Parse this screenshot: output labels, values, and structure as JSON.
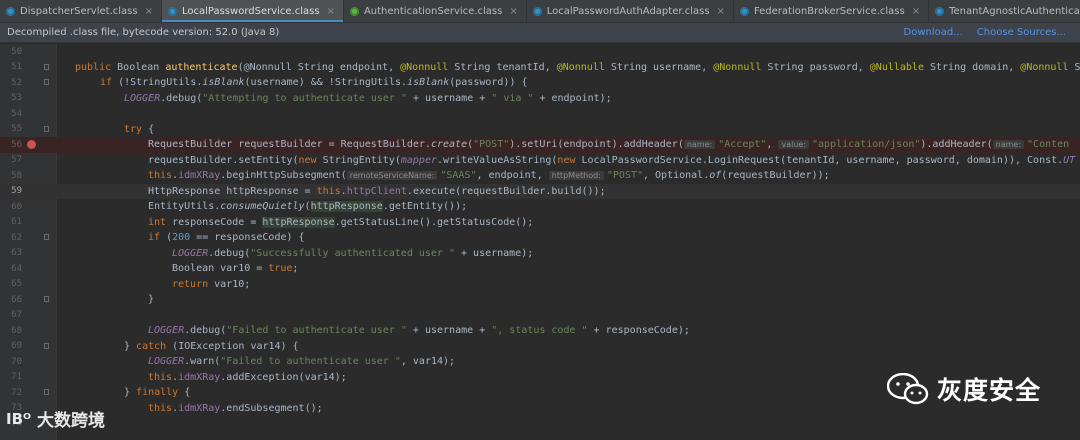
{
  "tabs": [
    {
      "label": "DispatcherServlet.class",
      "icon": "java-class-icon",
      "active": false
    },
    {
      "label": "LocalPasswordService.class",
      "icon": "java-class-icon",
      "active": true
    },
    {
      "label": "AuthenticationService.class",
      "icon": "java-class-green-icon",
      "active": false
    },
    {
      "label": "LocalPasswordAuthAdapter.class",
      "icon": "java-class-icon",
      "active": false
    },
    {
      "label": "FederationBrokerService.class",
      "icon": "java-class-icon",
      "active": false
    },
    {
      "label": "TenantAgnosticAuthenticationController.class",
      "icon": "java-class-icon",
      "active": false
    }
  ],
  "banner": {
    "message": "Decompiled .class file, bytecode version: 52.0 (Java 8)",
    "download_label": "Download...",
    "choose_sources_label": "Choose Sources..."
  },
  "editor": {
    "current_line": "59",
    "breakpoint_line": "56",
    "lines": [
      {
        "n": "50"
      },
      {
        "n": "51"
      },
      {
        "n": "52"
      },
      {
        "n": "53"
      },
      {
        "n": "54"
      },
      {
        "n": "55"
      },
      {
        "n": "56"
      },
      {
        "n": "57"
      },
      {
        "n": "58"
      },
      {
        "n": "59"
      },
      {
        "n": "60"
      },
      {
        "n": "61"
      },
      {
        "n": "62"
      },
      {
        "n": "63"
      },
      {
        "n": "64"
      },
      {
        "n": "65"
      },
      {
        "n": "66"
      },
      {
        "n": "67"
      },
      {
        "n": "68"
      },
      {
        "n": "69"
      },
      {
        "n": "70"
      },
      {
        "n": "71"
      },
      {
        "n": "72"
      },
      {
        "n": "73"
      },
      {
        "n": "74"
      }
    ],
    "code": {
      "l51_a": "public ",
      "l51_b": "Boolean ",
      "l51_c": "authenticate",
      "l51_d": "(@Nonnull String endpoint, ",
      "l51_e": "@Nonnull",
      "l51_f": " String tenantId, ",
      "l51_g": "@Nonnull",
      "l51_h": " String username, ",
      "l51_i": "@Nonnull",
      "l51_j": " String password, ",
      "l51_k": "@Nullable",
      "l51_l": " String domain, ",
      "l51_m": "@Nonnull",
      "l51_n": " S",
      "l52_a": "if",
      "l52_b": " (!StringUtils.",
      "l52_c": "isBlank",
      "l52_d": "(username) && !StringUtils.",
      "l52_e": "isBlank",
      "l52_f": "(password)) {",
      "l53_a": "LOGGER",
      "l53_b": ".debug(",
      "l53_c": "\"Attempting to authenticate user \"",
      "l53_d": " + username + ",
      "l53_e": "\" via \"",
      "l53_f": " + endpoint);",
      "l55_a": "try",
      "l55_b": " {",
      "l56_a": "RequestBuilder requestBuilder = RequestBuilder.",
      "l56_b": "create",
      "l56_c": "(",
      "l56_d": "\"POST\"",
      "l56_e": ").setUri(endpoint).addHeader(",
      "l56_h1": "name:",
      "l56_f": "\"Accept\"",
      "l56_g": ", ",
      "l56_h2": "value:",
      "l56_i": "\"application/json\"",
      "l56_j": ").addHeader(",
      "l56_h3": "name:",
      "l56_k": "\"Conten",
      "l57_a": "requestBuilder.setEntity(",
      "l57_b": "new",
      "l57_c": " StringEntity(",
      "l57_d": "mapper",
      "l57_e": ".writeValueAsString(",
      "l57_f": "new",
      "l57_g": " LocalPasswordService.LoginRequest(tenantId, username, password, domain)), Const.",
      "l57_h": "UT",
      "l58_a": "this",
      "l58_b": ".",
      "l58_c": "idmXRay",
      "l58_d": ".beginHttpSubsegment(",
      "l58_h1": "remoteServiceName:",
      "l58_e": "\"SAAS\"",
      "l58_f": ", endpoint, ",
      "l58_h2": "httpMethod:",
      "l58_g": "\"POST\"",
      "l58_i": ", Optional.",
      "l58_j": "of",
      "l58_k": "(requestBuilder));",
      "l59_a": "HttpResponse httpResponse = ",
      "l59_b": "this",
      "l59_c": ".",
      "l59_d": "httpClient",
      "l59_e": ".execute(requestBuilder.build());",
      "l60_a": "EntityUtils.",
      "l60_b": "consumeQuietly",
      "l60_c": "(",
      "l60_d": "httpResponse",
      "l60_e": ".getEntity());",
      "l61_a": "int",
      "l61_b": " responseCode = ",
      "l61_c": "httpResponse",
      "l61_d": ".getStatusLine().getStatusCode();",
      "l62_a": "if",
      "l62_b": " (",
      "l62_c": "200",
      "l62_d": " == responseCode) {",
      "l63_a": "LOGGER",
      "l63_b": ".debug(",
      "l63_c": "\"Successfully authenticated user \"",
      "l63_d": " + username);",
      "l64_a": "Boolean var10 = ",
      "l64_b": "true",
      "l64_c": ";",
      "l65_a": "return",
      "l65_b": " var10;",
      "l66_a": "}",
      "l68_a": "LOGGER",
      "l68_b": ".debug(",
      "l68_c": "\"Failed to authenticate user \"",
      "l68_d": " + username + ",
      "l68_e": "\", status code \"",
      "l68_f": " + responseCode);",
      "l69_a": "} ",
      "l69_b": "catch",
      "l69_c": " (IOException var14) {",
      "l70_a": "LOGGER",
      "l70_b": ".warn(",
      "l70_c": "\"Failed to authenticate user \"",
      "l70_d": ", var14);",
      "l71_a": "this",
      "l71_b": ".",
      "l71_c": "idmXRay",
      "l71_d": ".addException(var14);",
      "l72_a": "} ",
      "l72_b": "finally",
      "l72_c": " {",
      "l73_a": "this",
      "l73_b": ".",
      "l73_c": "idmXRay",
      "l73_d": ".endSubsegment();"
    }
  },
  "watermarks": {
    "right_text": "灰度安全",
    "left_logo": "IBᴼ",
    "left_text": "大数跨境"
  },
  "colors": {
    "background": "#2b2b2b",
    "keyword": "#cc7832",
    "string": "#6a8759",
    "annotation": "#bbb529",
    "method_decl": "#ffc66d",
    "static_field": "#9876aa",
    "number": "#6897bb",
    "breakpoint": "#c75450",
    "link": "#5694e6"
  }
}
